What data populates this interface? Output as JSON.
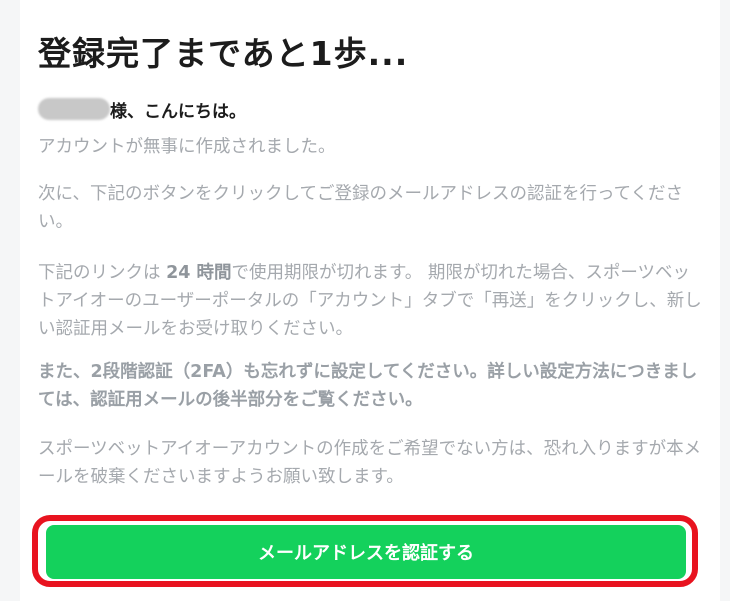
{
  "email": {
    "title": "登録完了まであと1歩...",
    "greeting": "様、こんにちは。",
    "paragraphs": {
      "account_created": "アカウントが無事に作成されました。",
      "next_step": "次に、下記のボタンをクリックしてご登録のメールアドレスの認証を行ってください。",
      "link_expiry_before": "下記のリンクは ",
      "link_expiry_hours": "24 時間",
      "link_expiry_after": "で使用期限が切れます。 期限が切れた場合、スポーツベットアイオーのユーザーポータルの「アカウント」タブで「再送」をクリックし、新しい認証用メールをお受け取りください。",
      "two_factor": "また、2段階認証（2FA）も忘れずに設定してください。詳しい設定方法につきましては、認証用メールの後半部分をご覧ください。",
      "not_requested": "スポーツベットアイオーアカウントの作成をご希望でない方は、恐れ入りますが本メールを破棄くださいますようお願い致します。"
    },
    "verify_button_label": "メールアドレスを認証する",
    "colors": {
      "button": "#14d15c",
      "highlight_outline": "#e8131f",
      "body_text": "#a5a9ae"
    }
  }
}
